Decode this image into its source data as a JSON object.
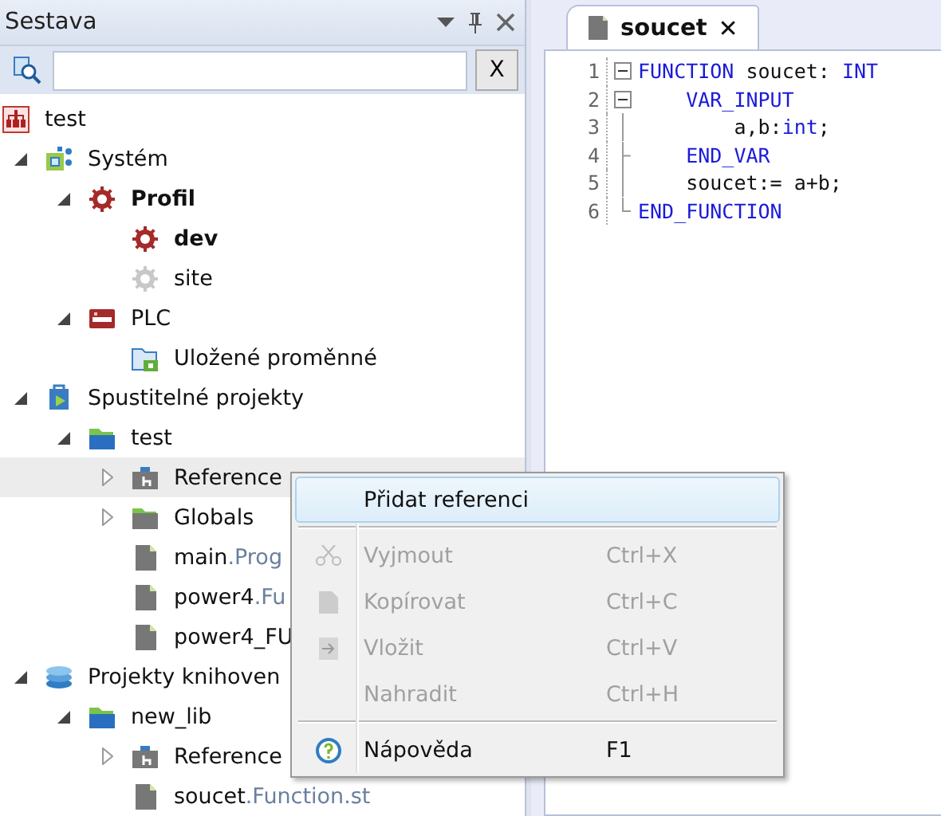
{
  "panel": {
    "title": "Sestava",
    "clear_button": "X"
  },
  "tree": [
    {
      "kind": "root",
      "name": "test",
      "active": false,
      "selected": false,
      "children": [
        {
          "kind": "system",
          "name": "Systém",
          "expanded": true,
          "active": false,
          "selected": false,
          "children": [
            {
              "kind": "profile",
              "name": "Profil",
              "expanded": true,
              "active": true,
              "selected": false,
              "children": [
                {
                  "kind": "profile",
                  "name": "dev",
                  "active": true,
                  "selected": false
                },
                {
                  "kind": "profile-off",
                  "name": "site",
                  "active": false,
                  "selected": false
                }
              ]
            },
            {
              "kind": "plc",
              "name": "PLC",
              "expanded": true,
              "active": false,
              "selected": false,
              "children": [
                {
                  "kind": "vars-folder",
                  "name": "Uložené proměnné",
                  "active": false,
                  "selected": false
                }
              ]
            }
          ]
        },
        {
          "kind": "exec-projects",
          "name": "Spustitelné projekty",
          "expanded": true,
          "active": false,
          "selected": false,
          "children": [
            {
              "kind": "folder",
              "name": "test",
              "expanded": true,
              "active": false,
              "selected": false,
              "children": [
                {
                  "kind": "references",
                  "name": "Reference",
                  "expanded": false,
                  "active": false,
                  "selected": true
                },
                {
                  "kind": "grey-folder",
                  "name": "Globals",
                  "expanded": false,
                  "active": false,
                  "selected": false
                },
                {
                  "kind": "file",
                  "name": "main",
                  "ext": ".Prog",
                  "active": false,
                  "selected": false
                },
                {
                  "kind": "file",
                  "name": "power4",
                  "ext": ".Fu",
                  "active": false,
                  "selected": false
                },
                {
                  "kind": "file",
                  "name": "power4_FU",
                  "active": false,
                  "selected": false
                }
              ]
            }
          ]
        },
        {
          "kind": "libraries",
          "name": "Projekty knihoven",
          "expanded": true,
          "active": false,
          "selected": false,
          "children": [
            {
              "kind": "folder",
              "name": "new_lib",
              "expanded": true,
              "active": false,
              "selected": false,
              "children": [
                {
                  "kind": "references",
                  "name": "Reference",
                  "expanded": false,
                  "active": false,
                  "selected": false
                },
                {
                  "kind": "file",
                  "name": "soucet",
                  "ext": ".Function.st",
                  "active": false,
                  "selected": false
                }
              ]
            }
          ]
        }
      ]
    }
  ],
  "editor": {
    "tabs": [
      {
        "title": "soucet",
        "close": "✕",
        "selected": true
      }
    ],
    "lines": [
      {
        "number": "1",
        "kind": "fold-start",
        "tokens": [
          {
            "kind": "keyword",
            "text": "FUNCTION"
          },
          {
            "kind": "plain",
            "text": " soucet: "
          },
          {
            "kind": "keyword",
            "text": "INT"
          }
        ]
      },
      {
        "number": "2",
        "kind": "fold-start",
        "tokens": [
          {
            "kind": "keyword",
            "text": "    VAR_INPUT"
          }
        ]
      },
      {
        "number": "3",
        "kind": "fold-body",
        "tokens": [
          {
            "kind": "plain",
            "text": "        a,b:"
          },
          {
            "kind": "keyword",
            "text": "int"
          },
          {
            "kind": "plain",
            "text": ";"
          }
        ]
      },
      {
        "number": "4",
        "kind": "fold-inner-end",
        "tokens": [
          {
            "kind": "keyword",
            "text": "    END_VAR"
          }
        ]
      },
      {
        "number": "5",
        "kind": "fold-body",
        "tokens": [
          {
            "kind": "plain",
            "text": "    soucet:= a+b;"
          }
        ]
      },
      {
        "number": "6",
        "kind": "fold-end",
        "tokens": [
          {
            "kind": "keyword",
            "text": "END_FUNCTION"
          }
        ]
      }
    ]
  },
  "context_menu": [
    {
      "kind": "item",
      "label": "Přidat referenci",
      "disabled": false,
      "selected": true
    },
    {
      "kind": "separator"
    },
    {
      "kind": "cut",
      "label": "Vyjmout",
      "shortcut": "Ctrl+X",
      "disabled": true,
      "selected": false
    },
    {
      "kind": "copy",
      "label": "Kopírovat",
      "shortcut": "Ctrl+C",
      "disabled": true,
      "selected": false
    },
    {
      "kind": "paste",
      "label": "Vložit",
      "shortcut": "Ctrl+V",
      "disabled": true,
      "selected": false
    },
    {
      "kind": "item",
      "label": "Nahradit",
      "shortcut": "Ctrl+H",
      "disabled": true,
      "selected": false
    },
    {
      "kind": "separator"
    },
    {
      "kind": "help",
      "label": "Nápověda",
      "shortcut": "F1",
      "disabled": false,
      "selected": false
    }
  ]
}
